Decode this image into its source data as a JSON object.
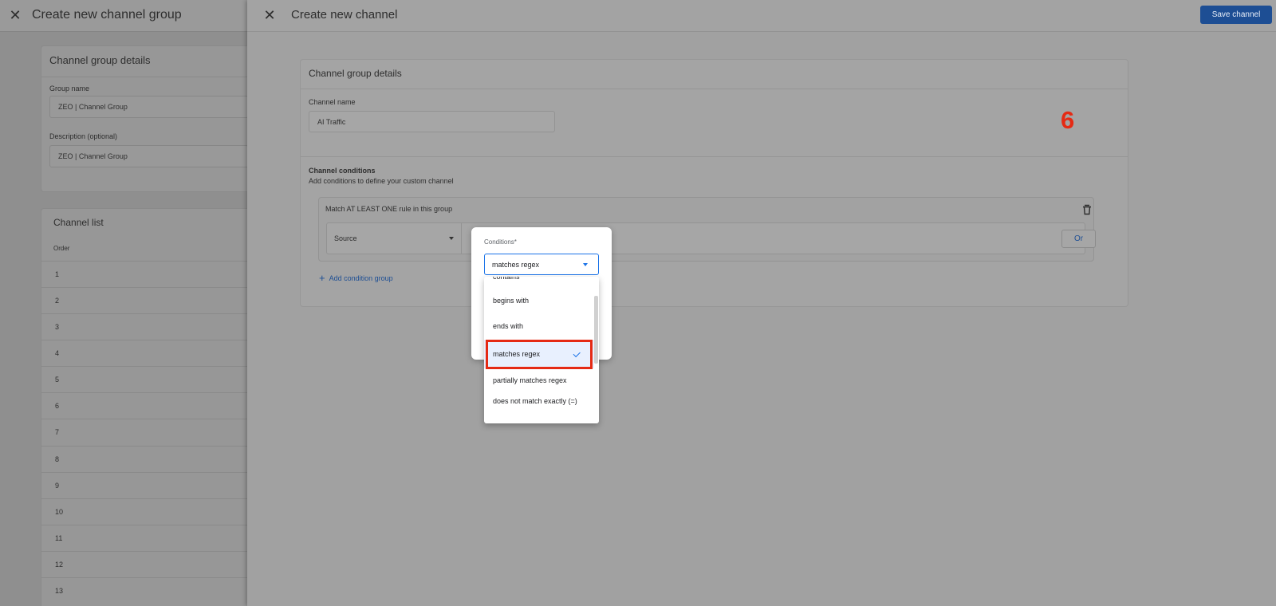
{
  "background": {
    "title": "Create new channel group",
    "details_title": "Channel group details",
    "group_name_label": "Group name",
    "group_name_value": "ZEO | Channel Group",
    "description_label": "Description (optional)",
    "description_value": "ZEO | Channel Group",
    "channel_list_title": "Channel list",
    "order_header": "Order",
    "rows": [
      "1",
      "2",
      "3",
      "4",
      "5",
      "6",
      "7",
      "8",
      "9",
      "10",
      "11",
      "12",
      "13"
    ]
  },
  "main": {
    "title": "Create new channel",
    "save_label": "Save channel",
    "details_title": "Channel group details",
    "channel_name_label": "Channel name",
    "channel_name_value": "AI Traffic",
    "annotation_number": "6",
    "conditions_title": "Channel conditions",
    "conditions_subtitle": "Add conditions to define your custom channel",
    "match_text": "Match AT LEAST ONE rule in this group",
    "source_label": "Source",
    "or_label": "Or",
    "add_group_label": "Add condition group"
  },
  "popup": {
    "label": "Conditions*",
    "selected": "matches regex",
    "options": [
      {
        "label": "contains",
        "selected": false
      },
      {
        "label": "begins with",
        "selected": false
      },
      {
        "label": "ends with",
        "selected": false
      },
      {
        "label": "matches regex",
        "selected": true
      },
      {
        "label": "partially matches regex",
        "selected": false
      },
      {
        "label": "does not match exactly (=)",
        "selected": false
      }
    ]
  },
  "colors": {
    "accent": "#1a73e8",
    "save_button": "#1d4e94",
    "annotation_red": "#e52a14",
    "selected_bg": "#e8f0fe"
  },
  "icons": [
    "close-icon",
    "trash-icon",
    "plus-icon",
    "dropdown-arrow-icon",
    "check-icon"
  ]
}
